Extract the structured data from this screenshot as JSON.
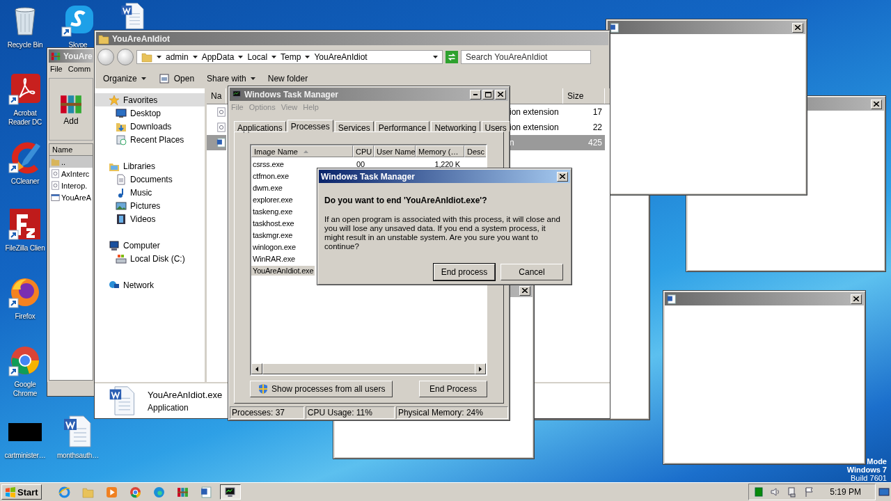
{
  "desktop": {
    "icons": [
      {
        "kind": "recycle",
        "label": "Recycle Bin",
        "shortcut": false
      },
      {
        "kind": "chat",
        "label": "Skype",
        "shortcut": true
      },
      {
        "kind": "worddoc",
        "shortcut": false
      },
      {
        "kind": "pdf",
        "label": "Acrobat Reader DC",
        "shortcut": true
      },
      {
        "kind": "brush",
        "label": "CCleaner",
        "shortcut": true
      },
      {
        "kind": "ftp",
        "label": "FileZilla Clien",
        "shortcut": true
      },
      {
        "kind": "firefox",
        "label": "Firefox",
        "shortcut": true
      },
      {
        "kind": "chrome",
        "label": "Google Chrome",
        "shortcut": true
      },
      {
        "kind": "blank",
        "label": "cartminister…",
        "shortcut": false
      },
      {
        "kind": "worddoc",
        "label": "monthsauth…",
        "shortcut": false
      }
    ],
    "edition_text": [
      "Mode",
      "Windows 7",
      "Build 7601"
    ]
  },
  "blank_windows": [
    {
      "kind": "blank"
    },
    {
      "kind": "blank"
    },
    {
      "kind": "blank",
      "icon": true
    },
    {
      "kind": "blank",
      "icon": true
    },
    {
      "kind": "blank"
    }
  ],
  "winrar": {
    "title": "YouAre",
    "menu": [
      "File",
      "Comm"
    ],
    "toolbar": [
      "Add"
    ],
    "column": "Name",
    "rows": [
      {
        "name": "..",
        "kind": "up",
        "selected": true
      },
      {
        "name": "AxInterc",
        "kind": "dll",
        "selected": false
      },
      {
        "name": "Interop.",
        "kind": "dll",
        "selected": false
      },
      {
        "name": "YouAreA",
        "kind": "exe",
        "selected": false
      }
    ]
  },
  "explorer": {
    "title": "YouAreAnIdiot",
    "breadcrumb": [
      "admin",
      "AppData",
      "Local",
      "Temp",
      "YouAreAnIdiot"
    ],
    "search": {
      "placeholder": "Search YouAreAnIdiot"
    },
    "toolbar": [
      {
        "label": "Organize",
        "kind": "menu"
      },
      {
        "label": "Open",
        "kind": "open"
      },
      {
        "label": "Share with",
        "kind": "menu"
      },
      {
        "label": "New folder",
        "kind": "plain"
      }
    ],
    "nav": [
      {
        "label": "Favorites",
        "kind": "star",
        "selected": true,
        "children": [
          {
            "label": "Desktop",
            "kind": "monitor",
            "selected": false
          },
          {
            "label": "Downloads",
            "kind": "download",
            "selected": false
          },
          {
            "label": "Recent Places",
            "kind": "recent",
            "selected": false
          }
        ]
      },
      {
        "label": "Libraries",
        "kind": "library",
        "selected": false,
        "children": [
          {
            "label": "Documents",
            "kind": "document",
            "selected": false
          },
          {
            "label": "Music",
            "kind": "music",
            "selected": false
          },
          {
            "label": "Pictures",
            "kind": "picture",
            "selected": false
          },
          {
            "label": "Videos",
            "kind": "video",
            "selected": false
          }
        ]
      },
      {
        "label": "Computer",
        "kind": "computer",
        "selected": false,
        "children": [
          {
            "label": "Local Disk (C:)",
            "kind": "disk",
            "selected": false
          }
        ]
      },
      {
        "label": "Network",
        "kind": "network",
        "selected": false
      }
    ],
    "files": {
      "name_column": "Na",
      "size_column": "Size",
      "rows": [
        {
          "kind": "dll",
          "column_2": "ion extension",
          "size": "17",
          "selected": false
        },
        {
          "kind": "dll",
          "column_2": "ion extension",
          "size": "22",
          "selected": false
        },
        {
          "kind": "word",
          "column_2": "n",
          "size": "425",
          "selected": true
        }
      ]
    },
    "details": {
      "name": "YouAreAnIdiot.exe",
      "type": "Application"
    }
  },
  "task_manager": {
    "title": "Windows Task Manager",
    "menu": [
      {
        "label": "File",
        "disabled": true
      },
      {
        "label": "Options",
        "disabled": true
      },
      {
        "label": "View",
        "disabled": true
      },
      {
        "label": "Help",
        "disabled": true
      }
    ],
    "tabs": [
      {
        "label": "Applications",
        "selected": false
      },
      {
        "label": "Processes",
        "selected": true
      },
      {
        "label": "Services",
        "selected": false
      },
      {
        "label": "Performance",
        "selected": false
      },
      {
        "label": "Networking",
        "selected": false
      },
      {
        "label": "Users",
        "selected": false
      }
    ],
    "columns": [
      {
        "label": "Image Name",
        "sorted": true
      },
      {
        "label": "CPU"
      },
      {
        "label": "User Name"
      },
      {
        "label": "Memory (…"
      },
      {
        "label": "Desc"
      }
    ],
    "rows": [
      {
        "image_name": "csrss.exe",
        "cpu": "00",
        "memory": "1,220 K",
        "selected": false
      },
      {
        "image_name": "ctfmon.exe",
        "selected": false
      },
      {
        "image_name": "dwm.exe",
        "selected": false
      },
      {
        "image_name": "explorer.exe",
        "selected": false
      },
      {
        "image_name": "taskeng.exe",
        "selected": false
      },
      {
        "image_name": "taskhost.exe",
        "selected": false
      },
      {
        "image_name": "taskmgr.exe",
        "selected": false
      },
      {
        "image_name": "winlogon.exe",
        "selected": false
      },
      {
        "image_name": "WinRAR.exe",
        "selected": false
      },
      {
        "image_name": "YouAreAnIdiot.exe",
        "selected": true
      }
    ],
    "show_all_button": "Show processes from all users",
    "end_button": "End Process",
    "status": [
      "Processes: 37",
      "CPU Usage: 11%",
      "Physical Memory: 24%"
    ]
  },
  "dialog": {
    "title": "Windows Task Manager",
    "heading": "Do you want to end 'YouAreAnIdiot.exe'?",
    "body": "If an open program is associated with this process, it will close and you will lose any unsaved data. If you end a system process, it might result in an unstable system. Are you sure you want to continue?",
    "buttons": [
      {
        "label": "End process",
        "default": true
      },
      {
        "label": "Cancel",
        "default": false
      }
    ]
  },
  "taskbar": {
    "start": "Start",
    "apps": [
      {
        "kind": "ie",
        "active": false
      },
      {
        "kind": "folder",
        "active": false
      },
      {
        "kind": "media",
        "active": false
      },
      {
        "kind": "chrome",
        "active": false
      },
      {
        "kind": "edge",
        "active": false
      },
      {
        "kind": "winrar",
        "active": false
      },
      {
        "kind": "word",
        "active": false
      },
      {
        "kind": "taskmgr",
        "active": true
      }
    ],
    "tray": [
      {
        "kind": "green"
      },
      {
        "kind": "speaker"
      },
      {
        "kind": "network"
      },
      {
        "kind": "flag"
      }
    ],
    "clock": "5:19 PM"
  }
}
